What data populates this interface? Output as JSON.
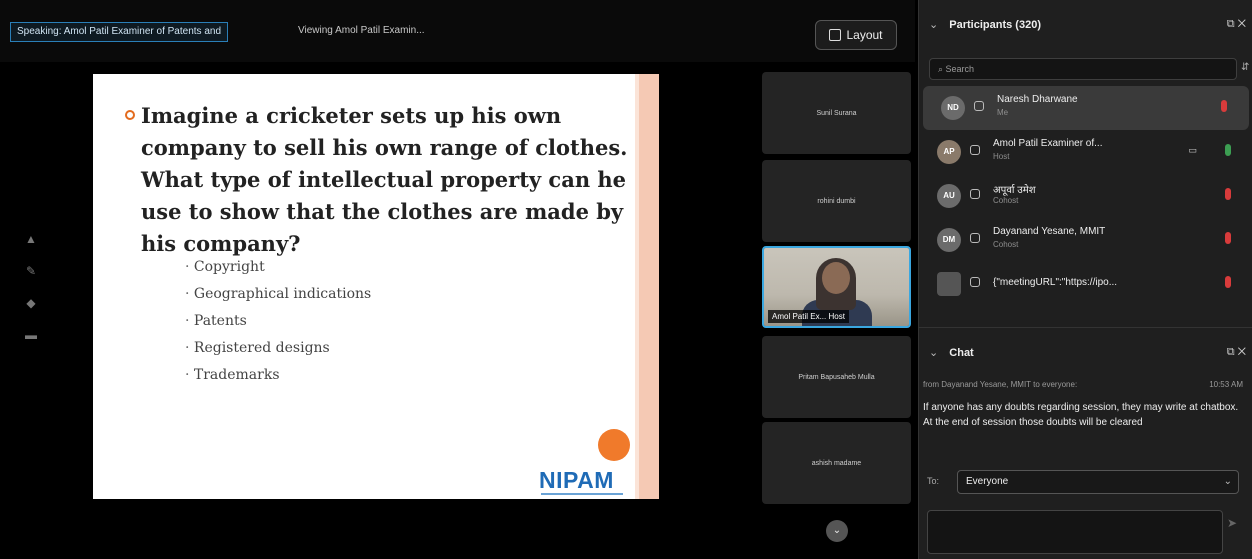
{
  "topbar": {
    "speaking": "Speaking: Amol Patil Examiner of Patents and",
    "viewing": "Viewing Amol Patil Examin...",
    "layout_label": "Layout"
  },
  "left_tools": [
    "pointer-icon",
    "pen-icon",
    "stamp-icon",
    "eraser-icon"
  ],
  "slide": {
    "question": "Imagine a cricketer sets up his own company to sell his own range of clothes. What type of intellectual property can he use to show that the clothes are made by his company?",
    "options": [
      "Copyright",
      "Geographical indications",
      "Patents",
      "Registered designs",
      "Trademarks"
    ],
    "logo": "NIPAM",
    "accent": "#e36b1e"
  },
  "tiles": [
    {
      "name": "Sunil Surana"
    },
    {
      "name": "rohini dumbi"
    },
    {
      "name": "Amol Patil Ex...",
      "badge": "Host"
    },
    {
      "name": "Pritam Bapusaheb Mulla"
    },
    {
      "name": "ashish madame"
    }
  ],
  "participants": {
    "title": "Participants (320)",
    "search_placeholder": "Search",
    "items": [
      {
        "initials": "ND",
        "name": "Naresh Dharwane",
        "role": "Me",
        "mic": "muted"
      },
      {
        "initials": "AP",
        "name": "Amol Patil Examiner of...",
        "role": "Host",
        "mic": "on"
      },
      {
        "initials": "AU",
        "name": "अपूर्वा उमेश",
        "role": "Cohost",
        "mic": "muted"
      },
      {
        "initials": "DM",
        "name": "Dayanand Yesane, MMIT",
        "role": "Cohost",
        "mic": "muted"
      },
      {
        "initials": "",
        "name": "{\"meetingURL\":\"https://ipo...",
        "role": "",
        "mic": "muted"
      }
    ]
  },
  "chat": {
    "title": "Chat",
    "meta": "from Dayanand Yesane, MMIT to everyone:",
    "time": "10:53 AM",
    "message": "If anyone has any doubts regarding session, they may write at chatbox. At the end of session those doubts will be cleared",
    "to_label": "To:",
    "to_value": "Everyone"
  },
  "colors": {
    "active_border": "#3aa7e0",
    "muted": "#d83b3b",
    "unmuted": "#3c9e52",
    "logo": "#1f6bb6"
  }
}
